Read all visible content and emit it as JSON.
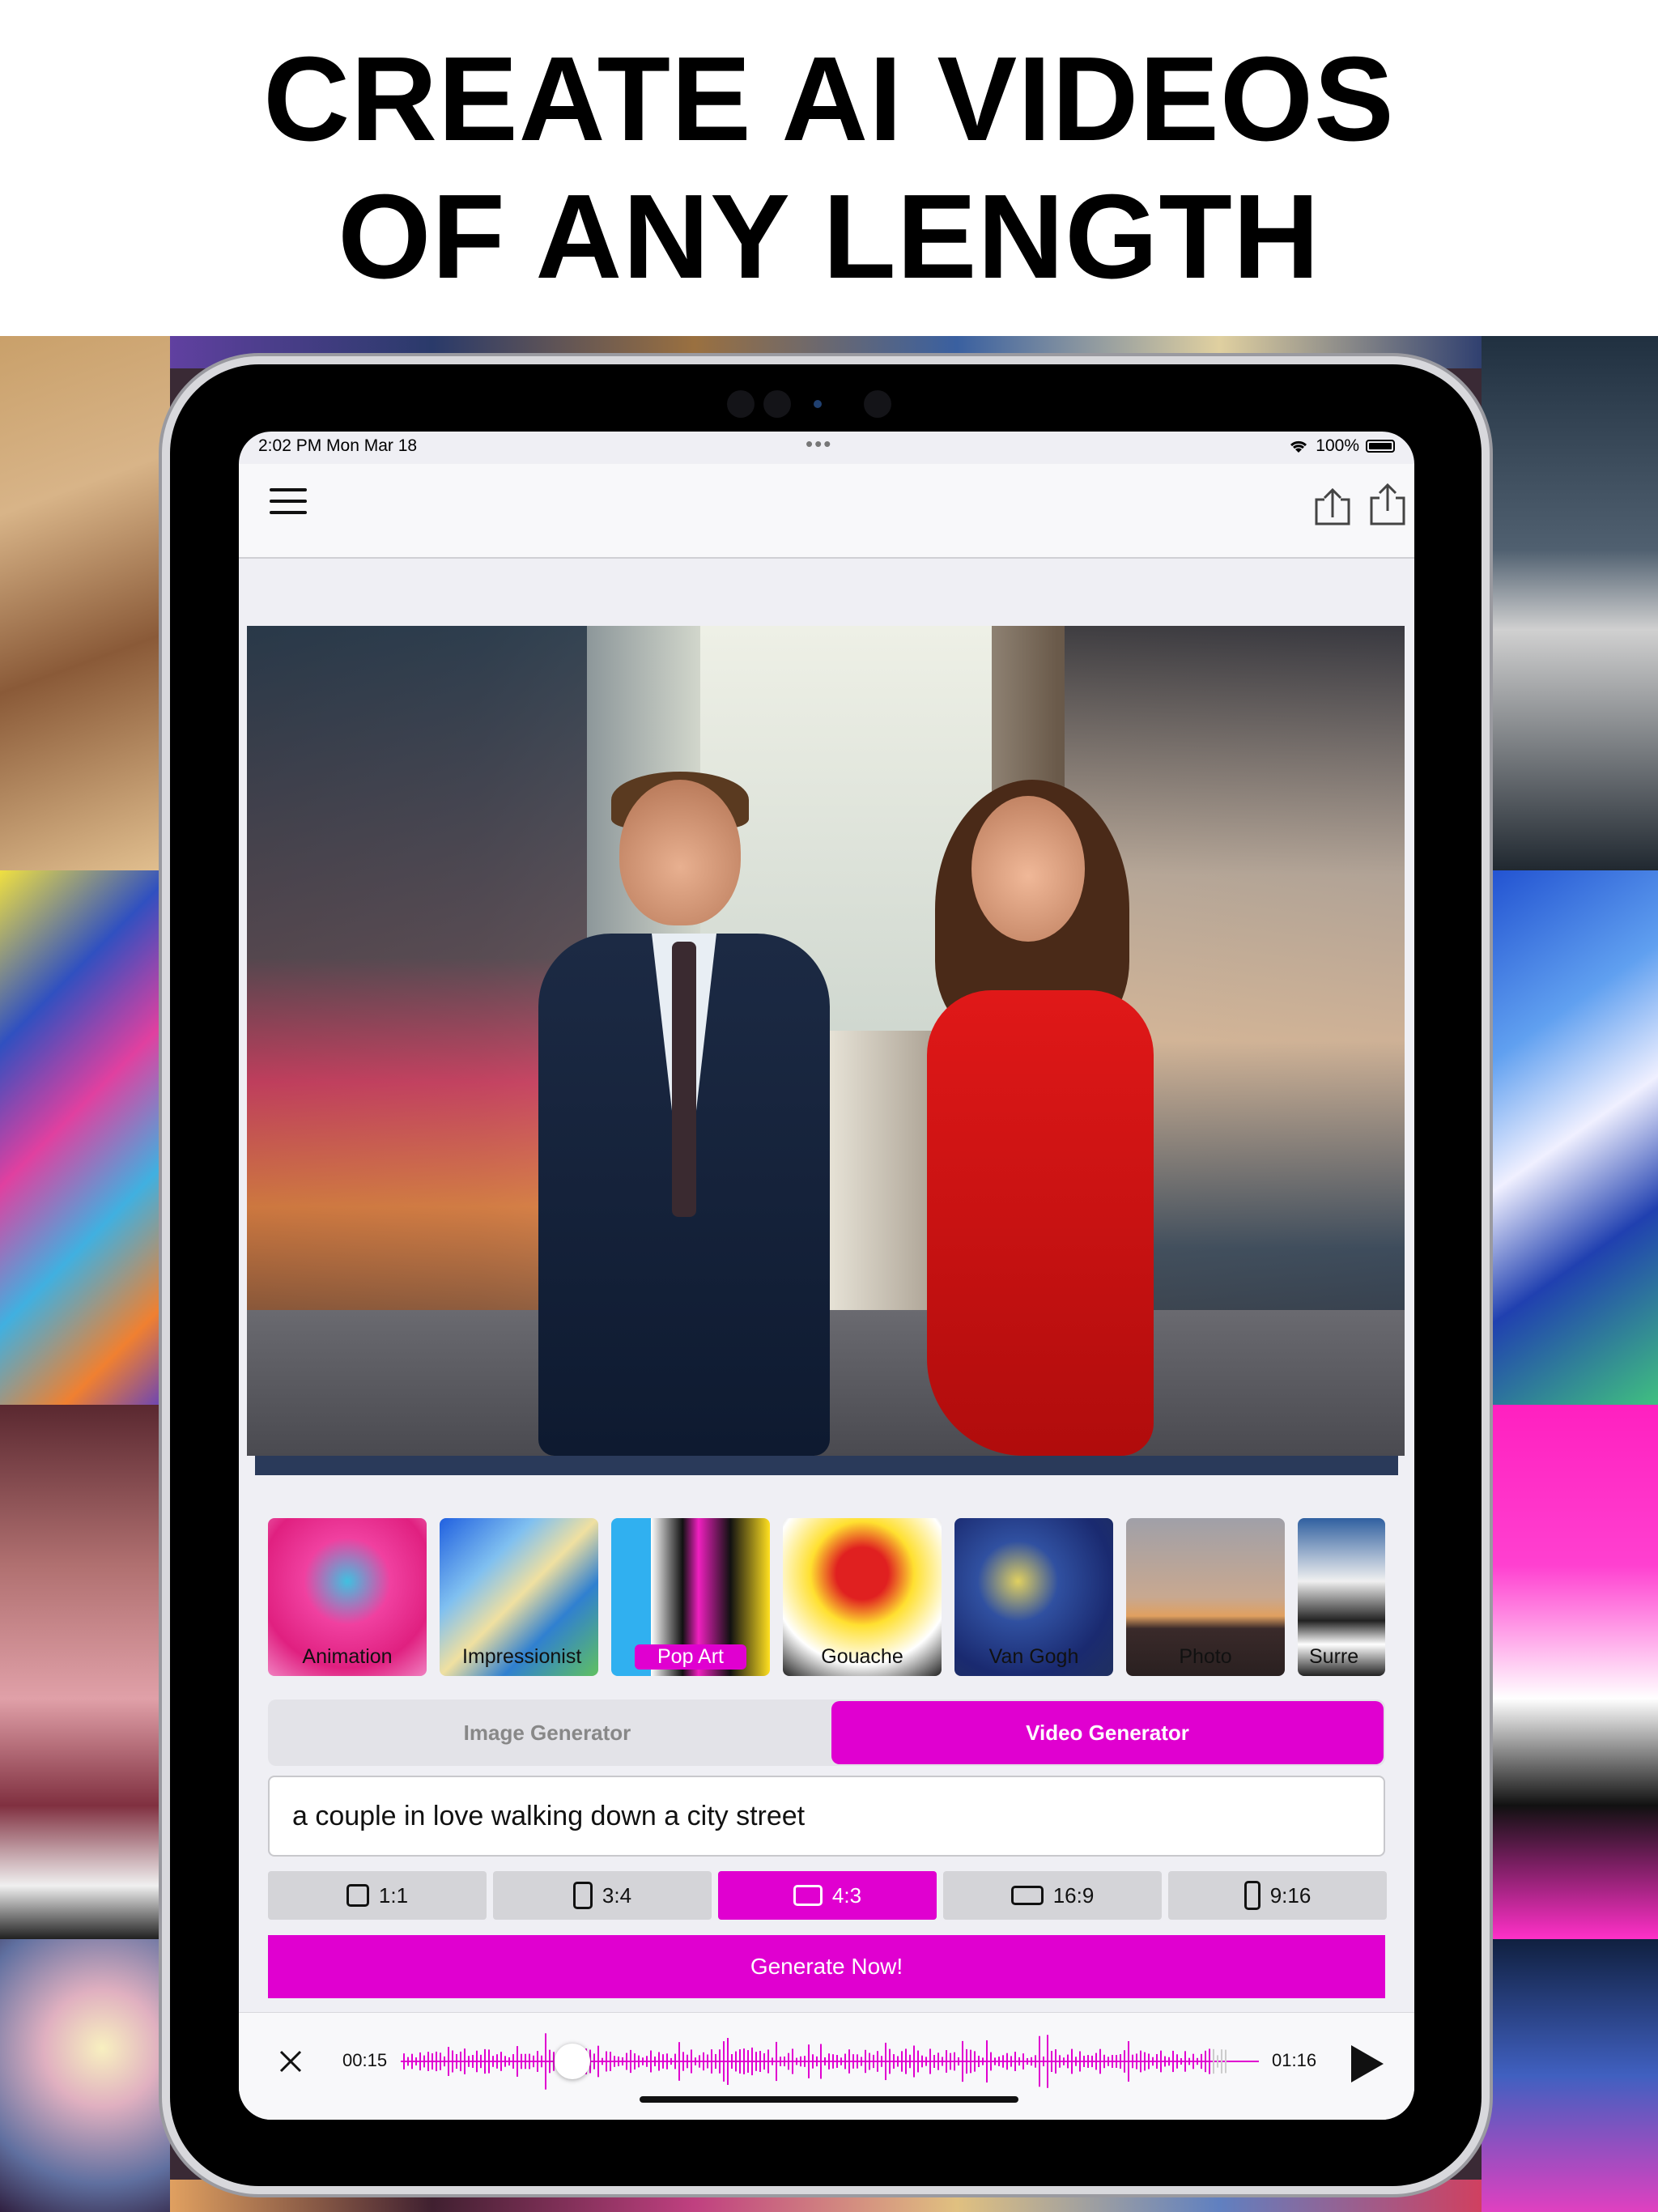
{
  "headline": {
    "line1": "CREATE AI VIDEOS",
    "line2": "OF ANY LENGTH"
  },
  "status_bar": {
    "time": "2:02 PM   Mon Mar 18",
    "battery": "100%"
  },
  "icons": {
    "menu": "hamburger-menu-icon",
    "import": "import-icon",
    "share": "share-icon",
    "wifi": "wifi-icon",
    "battery": "battery-icon",
    "close": "close-icon",
    "play": "play-icon"
  },
  "styles": [
    {
      "label": "Animation",
      "selected": false
    },
    {
      "label": "Impressionist",
      "selected": false
    },
    {
      "label": "Pop Art",
      "selected": true
    },
    {
      "label": "Gouache",
      "selected": false
    },
    {
      "label": "Van Gogh",
      "selected": false
    },
    {
      "label": "Photo",
      "selected": false
    },
    {
      "label": "Surre",
      "selected": false
    }
  ],
  "mode_tabs": {
    "image": "Image Generator",
    "video": "Video Generator",
    "active": "video"
  },
  "prompt": {
    "value": "a couple in love walking down a city street"
  },
  "aspect_ratios": [
    {
      "label": "1:1",
      "active": false
    },
    {
      "label": "3:4",
      "active": false
    },
    {
      "label": "4:3",
      "active": true
    },
    {
      "label": "16:9",
      "active": false
    },
    {
      "label": "9:16",
      "active": false
    }
  ],
  "generate_label": "Generate Now!",
  "player": {
    "current": "00:15",
    "total": "01:16",
    "progress": 0.2
  },
  "colors": {
    "accent": "#e000d0"
  }
}
